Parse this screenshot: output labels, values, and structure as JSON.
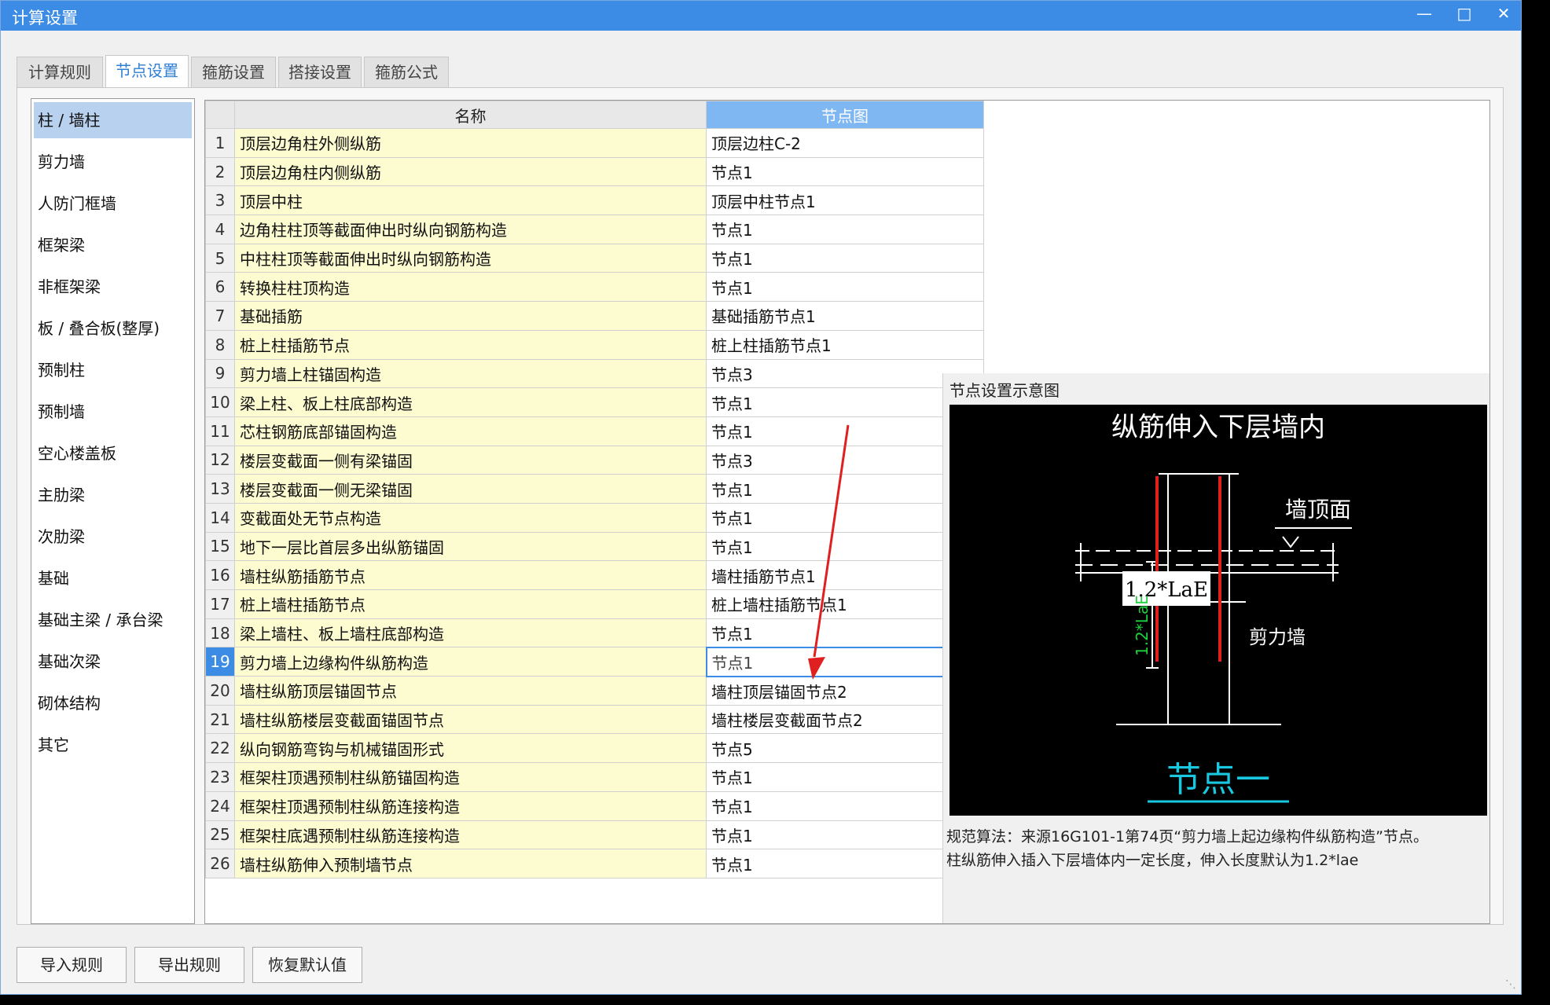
{
  "window": {
    "title": "计算设置"
  },
  "tabs": [
    "计算规则",
    "节点设置",
    "箍筋设置",
    "搭接设置",
    "箍筋公式"
  ],
  "active_tab": "节点设置",
  "categories": [
    "柱 / 墙柱",
    "剪力墙",
    "人防门框墙",
    "框架梁",
    "非框架梁",
    "板 / 叠合板(整厚)",
    "预制柱",
    "预制墙",
    "空心楼盖板",
    "主肋梁",
    "次肋梁",
    "基础",
    "基础主梁 / 承台梁",
    "基础次梁",
    "砌体结构",
    "其它"
  ],
  "selected_category": "柱 / 墙柱",
  "grid": {
    "headers": {
      "name": "名称",
      "node": "节点图"
    },
    "selected_row": "19",
    "rows": [
      {
        "idx": "1",
        "name": "顶层边角柱外侧纵筋",
        "node": "顶层边柱C-2"
      },
      {
        "idx": "2",
        "name": "顶层边角柱内侧纵筋",
        "node": "节点1"
      },
      {
        "idx": "3",
        "name": "顶层中柱",
        "node": "顶层中柱节点1"
      },
      {
        "idx": "4",
        "name": "边角柱柱顶等截面伸出时纵向钢筋构造",
        "node": "节点1"
      },
      {
        "idx": "5",
        "name": "中柱柱顶等截面伸出时纵向钢筋构造",
        "node": "节点1"
      },
      {
        "idx": "6",
        "name": "转换柱柱顶构造",
        "node": "节点1"
      },
      {
        "idx": "7",
        "name": "基础插筋",
        "node": "基础插筋节点1"
      },
      {
        "idx": "8",
        "name": "桩上柱插筋节点",
        "node": "桩上柱插筋节点1"
      },
      {
        "idx": "9",
        "name": "剪力墙上柱锚固构造",
        "node": "节点3"
      },
      {
        "idx": "10",
        "name": "梁上柱、板上柱底部构造",
        "node": "节点1"
      },
      {
        "idx": "11",
        "name": "芯柱钢筋底部锚固构造",
        "node": "节点1"
      },
      {
        "idx": "12",
        "name": "楼层变截面一侧有梁锚固",
        "node": "节点3"
      },
      {
        "idx": "13",
        "name": "楼层变截面一侧无梁锚固",
        "node": "节点1"
      },
      {
        "idx": "14",
        "name": "变截面处无节点构造",
        "node": "节点1"
      },
      {
        "idx": "15",
        "name": "地下一层比首层多出纵筋锚固",
        "node": "节点1"
      },
      {
        "idx": "16",
        "name": "墙柱纵筋插筋节点",
        "node": "墙柱插筋节点1"
      },
      {
        "idx": "17",
        "name": "桩上墙柱插筋节点",
        "node": "桩上墙柱插筋节点1"
      },
      {
        "idx": "18",
        "name": "梁上墙柱、板上墙柱底部构造",
        "node": "节点1"
      },
      {
        "idx": "19",
        "name": "剪力墙上边缘构件纵筋构造",
        "node": "节点1"
      },
      {
        "idx": "20",
        "name": "墙柱纵筋顶层锚固节点",
        "node": "墙柱顶层锚固节点2"
      },
      {
        "idx": "21",
        "name": "墙柱纵筋楼层变截面锚固节点",
        "node": "墙柱楼层变截面节点2"
      },
      {
        "idx": "22",
        "name": "纵向钢筋弯钩与机械锚固形式",
        "node": "节点5"
      },
      {
        "idx": "23",
        "name": "框架柱顶遇预制柱纵筋锚固构造",
        "node": "节点1"
      },
      {
        "idx": "24",
        "name": "框架柱顶遇预制柱纵筋连接构造",
        "node": "节点1"
      },
      {
        "idx": "25",
        "name": "框架柱底遇预制柱纵筋连接构造",
        "node": "节点1"
      },
      {
        "idx": "26",
        "name": "墙柱纵筋伸入预制墙节点",
        "node": "节点1"
      }
    ]
  },
  "preview": {
    "title": "节点设置示意图",
    "diagram": {
      "heading": "纵筋伸入下层墙内",
      "wall_top_label": "墙顶面",
      "length_label": "1.2*LaE",
      "wall_label": "剪力墙",
      "vertical_label_a": "1.2*LaE",
      "node_name": "节点一"
    },
    "desc_line1": "规范算法：来源16G101-1第74页“剪力墙上起边缘构件纵筋构造”节点。",
    "desc_line2": "柱纵筋伸入插入下层墙体内一定长度，伸入长度默认为1.2*lae"
  },
  "buttons": {
    "import": "导入规则",
    "export": "导出规则",
    "restore": "恢复默认值"
  },
  "colors": {
    "titlebar": "#3c8ce6",
    "selected_tab": "#2f7fd6",
    "name_column": "#fdfbd0",
    "annotation_arrow": "#e02020",
    "diagram_rebar": "#e02020",
    "diagram_label": "#19c8e0"
  }
}
